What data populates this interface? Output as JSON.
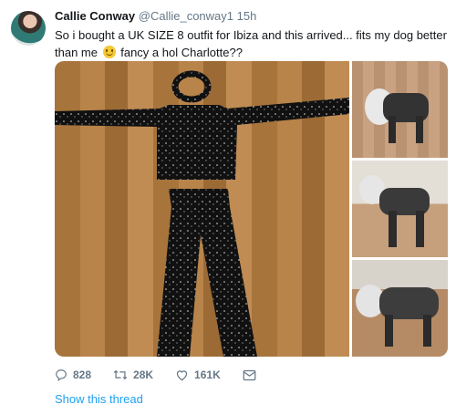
{
  "tweet": {
    "author_name": "Callie Conway",
    "handle": "@Callie_conway1",
    "time": "15h",
    "text_before_emoji": "So i bought a UK SIZE 8 outfit for Ibiza and this arrived... fits my dog better than me",
    "text_after_emoji": "fancy a hol Charlotte??"
  },
  "actions": {
    "replies": "828",
    "retweets": "28K",
    "likes": "161K"
  },
  "show_thread": "Show this thread",
  "colors": {
    "link": "#1da1f2",
    "muted": "#657786",
    "text": "#14171a"
  },
  "icons": [
    "reply-icon",
    "retweet-icon",
    "like-icon",
    "message-icon"
  ]
}
